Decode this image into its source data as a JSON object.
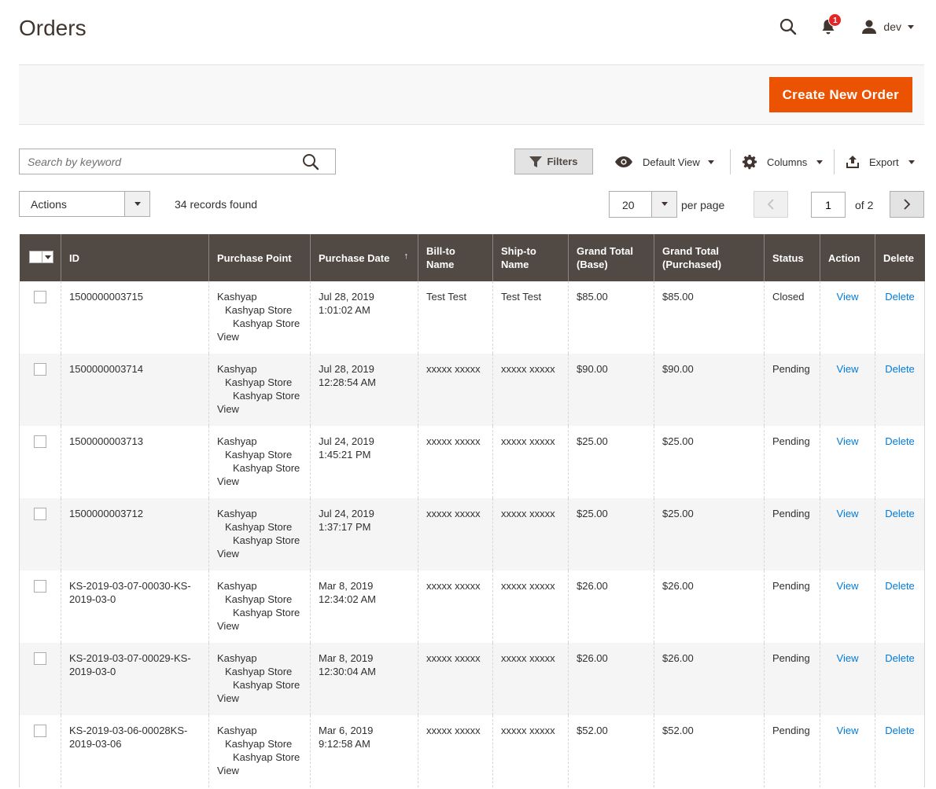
{
  "header": {
    "title": "Orders",
    "notification_count": "1",
    "user_name": "dev"
  },
  "action_bar": {
    "create_label": "Create New Order"
  },
  "toolbar": {
    "search_placeholder": "Search by keyword",
    "filters_label": "Filters",
    "view_label": "Default View",
    "columns_label": "Columns",
    "export_label": "Export",
    "actions_label": "Actions",
    "records_found": "34 records found",
    "per_page_value": "20",
    "per_page_label": "per page",
    "current_page": "1",
    "of_pages": "of 2"
  },
  "columns": {
    "id": "ID",
    "purchase_point": "Purchase Point",
    "purchase_date": "Purchase Date",
    "sort_indicator": "↑",
    "bill_to": "Bill-to Name",
    "ship_to": "Ship-to Name",
    "grand_base": "Grand Total (Base)",
    "grand_purchased": "Grand Total (Purchased)",
    "status": "Status",
    "action": "Action",
    "delete": "Delete"
  },
  "rows": [
    {
      "id": "1500000003715",
      "pp1": "Kashyap",
      "pp2": "Kashyap Store",
      "pp3": "Kashyap Store",
      "pp4": "View",
      "date1": "Jul 28, 2019",
      "date2": "1:01:02 AM",
      "bill": "Test Test",
      "ship": "Test Test",
      "base": "$85.00",
      "purchased": "$85.00",
      "status": "Closed",
      "action": "View",
      "delete": "Delete"
    },
    {
      "id": "1500000003714",
      "pp1": "Kashyap",
      "pp2": "Kashyap Store",
      "pp3": "Kashyap Store",
      "pp4": "View",
      "date1": "Jul 28, 2019",
      "date2": "12:28:54 AM",
      "bill": "xxxxx xxxxx",
      "ship": "xxxxx xxxxx",
      "base": "$90.00",
      "purchased": "$90.00",
      "status": "Pending",
      "action": "View",
      "delete": "Delete"
    },
    {
      "id": "1500000003713",
      "pp1": "Kashyap",
      "pp2": "Kashyap Store",
      "pp3": "Kashyap Store",
      "pp4": "View",
      "date1": "Jul 24, 2019",
      "date2": "1:45:21 PM",
      "bill": "xxxxx xxxxx",
      "ship": "xxxxx xxxxx",
      "base": "$25.00",
      "purchased": "$25.00",
      "status": "Pending",
      "action": "View",
      "delete": "Delete"
    },
    {
      "id": "1500000003712",
      "pp1": "Kashyap",
      "pp2": "Kashyap Store",
      "pp3": "Kashyap Store",
      "pp4": "View",
      "date1": "Jul 24, 2019",
      "date2": "1:37:17 PM",
      "bill": "xxxxx xxxxx",
      "ship": "xxxxx xxxxx",
      "base": "$25.00",
      "purchased": "$25.00",
      "status": "Pending",
      "action": "View",
      "delete": "Delete"
    },
    {
      "id": "KS-2019-03-07-00030-KS-2019-03-0",
      "pp1": "Kashyap",
      "pp2": "Kashyap Store",
      "pp3": "Kashyap Store",
      "pp4": "View",
      "date1": "Mar 8, 2019",
      "date2": "12:34:02 AM",
      "bill": "xxxxx xxxxx",
      "ship": "xxxxx xxxxx",
      "base": "$26.00",
      "purchased": "$26.00",
      "status": "Pending",
      "action": "View",
      "delete": "Delete"
    },
    {
      "id": "KS-2019-03-07-00029-KS-2019-03-0",
      "pp1": "Kashyap",
      "pp2": "Kashyap Store",
      "pp3": "Kashyap Store",
      "pp4": "View",
      "date1": "Mar 8, 2019",
      "date2": "12:30:04 AM",
      "bill": "xxxxx xxxxx",
      "ship": "xxxxx xxxxx",
      "base": "$26.00",
      "purchased": "$26.00",
      "status": "Pending",
      "action": "View",
      "delete": "Delete"
    },
    {
      "id": "KS-2019-03-06-00028KS-2019-03-06",
      "pp1": "Kashyap",
      "pp2": "Kashyap Store",
      "pp3": "Kashyap Store",
      "pp4": "View",
      "date1": "Mar 6, 2019",
      "date2": "9:12:58 AM",
      "bill": "xxxxx xxxxx",
      "ship": "xxxxx xxxxx",
      "base": "$52.00",
      "purchased": "$52.00",
      "status": "Pending",
      "action": "View",
      "delete": "Delete"
    }
  ],
  "colors": {
    "accent": "#eb5202",
    "header_bg": "#514943",
    "link": "#007bdb",
    "badge": "#e22626"
  },
  "icons": {
    "search": "search-icon",
    "bell": "bell-icon",
    "user": "user-icon",
    "filter": "filter-icon",
    "eye": "eye-icon",
    "gear": "gear-icon",
    "export": "export-icon"
  }
}
